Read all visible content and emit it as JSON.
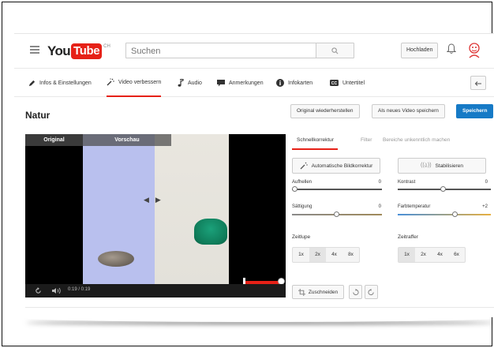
{
  "header": {
    "logo_you": "You",
    "logo_tube": "Tube",
    "logo_region": "CH",
    "search_placeholder": "Suchen",
    "upload_label": "Hochladen"
  },
  "tabs": [
    {
      "label": "Infos & Einstellungen",
      "icon": "pencil-icon"
    },
    {
      "label": "Video verbessern",
      "icon": "magic-wand-icon",
      "active": true
    },
    {
      "label": "Audio",
      "icon": "music-note-icon"
    },
    {
      "label": "Anmerkungen",
      "icon": "speech-bubble-icon"
    },
    {
      "label": "Infokarten",
      "icon": "info-icon"
    },
    {
      "label": "Untertitel",
      "icon": "cc-icon"
    }
  ],
  "page": {
    "title": "Natur",
    "revert_label": "Original wiederherstellen",
    "save_new_label": "Als neues Video speichern",
    "save_label": "Speichern"
  },
  "video": {
    "label_original": "Original",
    "label_preview": "Vorschau",
    "time": "0:19 / 0:19"
  },
  "panel": {
    "subtabs": [
      "Schnellkorrektur",
      "Filter",
      "Bereiche unkenntlich machen"
    ],
    "auto_label": "Automatische Bildkorrektur",
    "stabilize_label": "Stabilisieren",
    "sliders": [
      {
        "label": "Aufhellen",
        "value": "0",
        "level": 0.0
      },
      {
        "label": "Kontrast",
        "value": "0",
        "level": 0.5
      },
      {
        "label": "Sättigung",
        "value": "0",
        "level": 0.5
      },
      {
        "label": "Farbtemperatur",
        "value": "+2",
        "level": 0.6
      }
    ],
    "slowmo_label": "Zeitlupe",
    "timelapse_label": "Zeitraffer",
    "slowmo_options": [
      "1x",
      "2x",
      "4x",
      "8x"
    ],
    "timelapse_options": [
      "1x",
      "2x",
      "4x",
      "6x"
    ],
    "crop_label": "Zuschneiden"
  }
}
